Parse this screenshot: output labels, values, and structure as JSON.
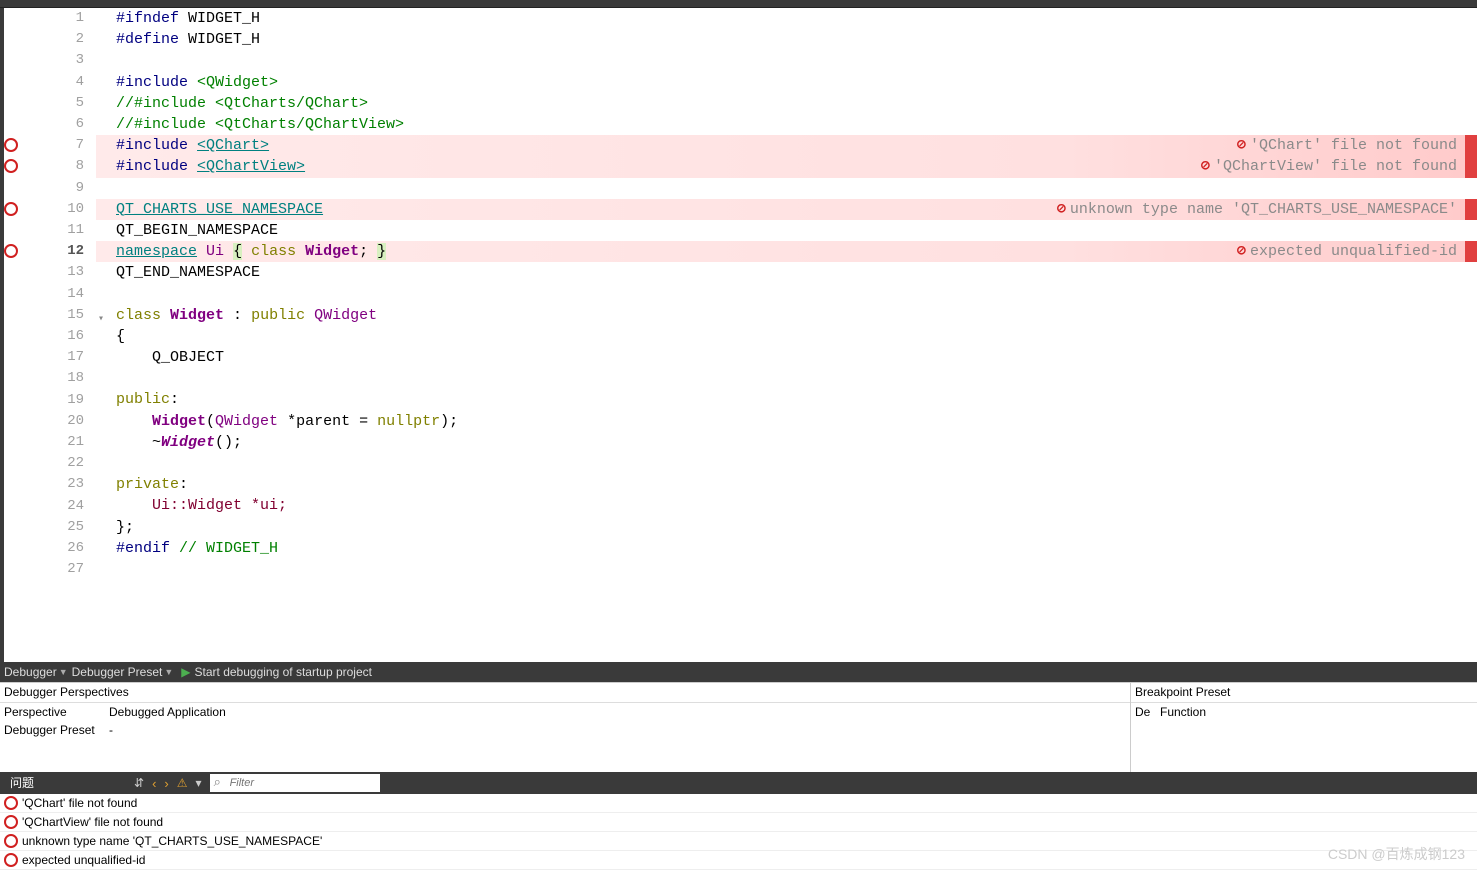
{
  "editor": {
    "lines": [
      {
        "num": 1,
        "err": false,
        "html": [
          {
            "t": "#ifndef",
            "c": "kw-navy"
          },
          {
            "t": " WIDGET_H"
          }
        ]
      },
      {
        "num": 2,
        "err": false,
        "html": [
          {
            "t": "#define",
            "c": "kw-navy"
          },
          {
            "t": " WIDGET_H"
          }
        ]
      },
      {
        "num": 3,
        "err": false,
        "html": []
      },
      {
        "num": 4,
        "err": false,
        "html": [
          {
            "t": "#include",
            "c": "kw-navy"
          },
          {
            "t": " "
          },
          {
            "t": "<QWidget>",
            "c": "kw-green"
          }
        ]
      },
      {
        "num": 5,
        "err": false,
        "html": [
          {
            "t": "//#include <QtCharts/QChart>",
            "c": "kw-comment"
          }
        ]
      },
      {
        "num": 6,
        "err": false,
        "html": [
          {
            "t": "//#include <QtCharts/QChartView>",
            "c": "kw-comment"
          }
        ]
      },
      {
        "num": 7,
        "err": true,
        "errText": "'QChart' file not found",
        "html": [
          {
            "t": "#include",
            "c": "kw-navy"
          },
          {
            "t": " "
          },
          {
            "t": "<QChart>",
            "c": "kw-teal"
          }
        ]
      },
      {
        "num": 8,
        "err": true,
        "errText": "'QChartView' file not found",
        "html": [
          {
            "t": "#include",
            "c": "kw-navy"
          },
          {
            "t": " "
          },
          {
            "t": "<QChartView>",
            "c": "kw-teal"
          }
        ]
      },
      {
        "num": 9,
        "err": false,
        "html": []
      },
      {
        "num": 10,
        "err": true,
        "errText": "unknown type name 'QT_CHARTS_USE_NAMESPACE'",
        "html": [
          {
            "t": "QT_CHARTS_USE_NAMESPACE",
            "c": "kw-teal"
          }
        ]
      },
      {
        "num": 11,
        "err": false,
        "html": [
          {
            "t": "QT_BEGIN_NAMESPACE"
          }
        ]
      },
      {
        "num": 12,
        "err": true,
        "current": true,
        "errText": "expected unqualified-id",
        "html": [
          {
            "t": "namespace",
            "c": "kw-teal"
          },
          {
            "t": " "
          },
          {
            "t": "Ui",
            "c": "kw-purple"
          },
          {
            "t": " "
          },
          {
            "t": "{",
            "c": "kw-brace"
          },
          {
            "t": " "
          },
          {
            "t": "class",
            "c": "kw-olive"
          },
          {
            "t": " "
          },
          {
            "t": "Widget",
            "c": "kw-purple kw-bold"
          },
          {
            "t": "; "
          },
          {
            "t": "}",
            "c": "kw-paren"
          }
        ]
      },
      {
        "num": 13,
        "err": false,
        "html": [
          {
            "t": "QT_END_NAMESPACE"
          }
        ]
      },
      {
        "num": 14,
        "err": false,
        "html": []
      },
      {
        "num": 15,
        "err": false,
        "fold": true,
        "html": [
          {
            "t": "class",
            "c": "kw-olive"
          },
          {
            "t": " "
          },
          {
            "t": "Widget",
            "c": "kw-purple kw-bold"
          },
          {
            "t": " : "
          },
          {
            "t": "public",
            "c": "kw-olive"
          },
          {
            "t": " QWidget",
            "c": "kw-purple"
          }
        ]
      },
      {
        "num": 16,
        "err": false,
        "html": [
          {
            "t": "{"
          }
        ]
      },
      {
        "num": 17,
        "err": false,
        "html": [
          {
            "t": "    Q_OBJECT"
          }
        ]
      },
      {
        "num": 18,
        "err": false,
        "html": []
      },
      {
        "num": 19,
        "err": false,
        "html": [
          {
            "t": "public",
            "c": "kw-olive"
          },
          {
            "t": ":"
          }
        ]
      },
      {
        "num": 20,
        "err": false,
        "html": [
          {
            "t": "    "
          },
          {
            "t": "Widget",
            "c": "kw-purple kw-bold"
          },
          {
            "t": "("
          },
          {
            "t": "QWidget",
            "c": "kw-purple"
          },
          {
            "t": " *parent = "
          },
          {
            "t": "nullptr",
            "c": "kw-olive"
          },
          {
            "t": ");"
          }
        ]
      },
      {
        "num": 21,
        "err": false,
        "html": [
          {
            "t": "    ~"
          },
          {
            "t": "Widget",
            "c": "kw-purple kw-bold kw-italic"
          },
          {
            "t": "();"
          }
        ]
      },
      {
        "num": 22,
        "err": false,
        "html": []
      },
      {
        "num": 23,
        "err": false,
        "html": [
          {
            "t": "private",
            "c": "kw-olive"
          },
          {
            "t": ":"
          }
        ]
      },
      {
        "num": 24,
        "err": false,
        "html": [
          {
            "t": "    Ui::Widget *ui;",
            "c": "kw-red"
          }
        ]
      },
      {
        "num": 25,
        "err": false,
        "html": [
          {
            "t": "};"
          }
        ]
      },
      {
        "num": 26,
        "err": false,
        "html": [
          {
            "t": "#endif",
            "c": "kw-navy"
          },
          {
            "t": " "
          },
          {
            "t": "// WIDGET_H",
            "c": "kw-comment"
          }
        ]
      },
      {
        "num": 27,
        "err": false,
        "html": []
      }
    ]
  },
  "debugToolbar": {
    "debugger": "Debugger",
    "preset": "Debugger Preset",
    "start": "Start debugging of startup project"
  },
  "debugPanels": {
    "leftHeader": "Debugger Perspectives",
    "rightHeader": "Breakpoint Preset",
    "leftRows": [
      {
        "c1": "Perspective",
        "c2": "Debugged Application"
      },
      {
        "c1": "Debugger Preset",
        "c2": "-"
      }
    ],
    "rightRows": [
      {
        "c1": "De",
        "c2": "Function"
      }
    ]
  },
  "issuesTab": "问题",
  "filterPlaceholder": "Filter",
  "issues": [
    "'QChart' file not found",
    "'QChartView' file not found",
    "unknown type name 'QT_CHARTS_USE_NAMESPACE'",
    "expected unqualified-id"
  ],
  "watermark": "CSDN @百炼成钢123"
}
